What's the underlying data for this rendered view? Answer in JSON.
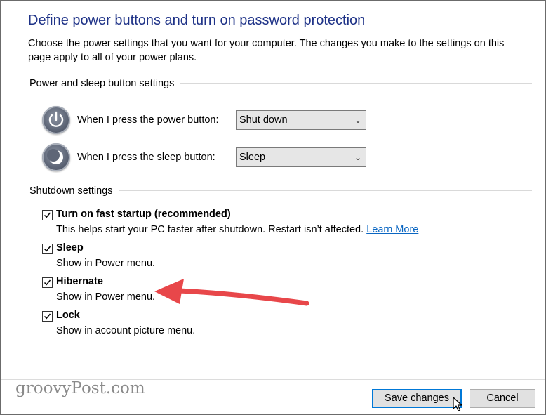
{
  "page": {
    "title": "Define power buttons and turn on password protection",
    "description": "Choose the power settings that you want for your computer. The changes you make to the settings on this page apply to all of your power plans."
  },
  "power_section": {
    "label": "Power and sleep button settings",
    "power_row": {
      "label": "When I press the power button:",
      "value": "Shut down"
    },
    "sleep_row": {
      "label": "When I press the sleep button:",
      "value": "Sleep"
    }
  },
  "shutdown_section": {
    "label": "Shutdown settings",
    "items": [
      {
        "title": "Turn on fast startup (recommended)",
        "desc": "This helps start your PC faster after shutdown. Restart isn’t affected.",
        "link": "Learn More",
        "checked": true
      },
      {
        "title": "Sleep",
        "desc": "Show in Power menu.",
        "checked": true
      },
      {
        "title": "Hibernate",
        "desc": "Show in Power menu.",
        "checked": true
      },
      {
        "title": "Lock",
        "desc": "Show in account picture menu.",
        "checked": true
      }
    ]
  },
  "footer": {
    "brand": "groovyPost.com",
    "save_label": "Save changes",
    "cancel_label": "Cancel"
  },
  "colors": {
    "title": "#1e3287",
    "link": "#0a66c2",
    "annotation_arrow": "#e8474a"
  },
  "icons": [
    "power-icon",
    "sleep-icon",
    "checkmark-icon",
    "chevron-down-icon",
    "mouse-cursor-icon",
    "annotation-arrow"
  ]
}
